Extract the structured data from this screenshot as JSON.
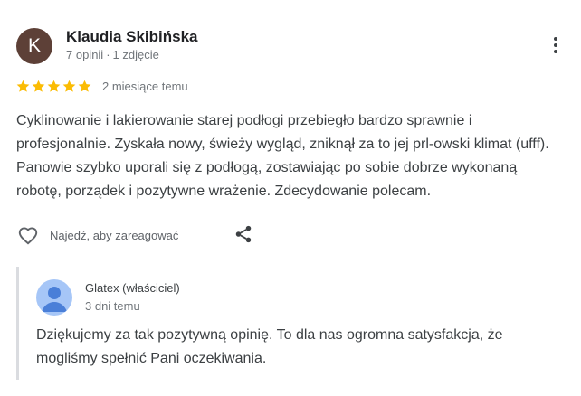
{
  "review": {
    "author": {
      "initial": "K",
      "name": "Klaudia Skibińska",
      "reviews_count": "7 opinii",
      "separator": "·",
      "photos_count": "1 zdjęcie",
      "avatar_color": "#5d4037"
    },
    "rating": {
      "value": 5,
      "max": 5,
      "star_color": "#fbbc04"
    },
    "date": "2 miesiące temu",
    "text": "Cyklinowanie i lakierowanie starej podłogi przebiegło bardzo sprawnie i profesjonalnie. Zyskała nowy, świeży wygląd, zniknął za to jej prl-owski klimat (ufff). Panowie szybko uporali się z podłogą, zostawiając po sobie dobrze wykonaną robotę, porządek i pozytywne wrażenie. Zdecydowanie polecam.",
    "more_icon": "more-vert-icon"
  },
  "actions": {
    "like_icon": "heart-outline-icon",
    "like_label": "Najedź, aby zareagować",
    "share_icon": "share-icon"
  },
  "owner_reply": {
    "name": "Glatex (właściciel)",
    "date": "3 dni temu",
    "text": "Dziękujemy za tak pozytywną opinię. To dla nas ogromna satysfakcja, że mogliśmy spełnić Pani oczekiwania.",
    "avatar_icon": "default-profile-icon",
    "avatar_color": "#a6c6f7"
  }
}
